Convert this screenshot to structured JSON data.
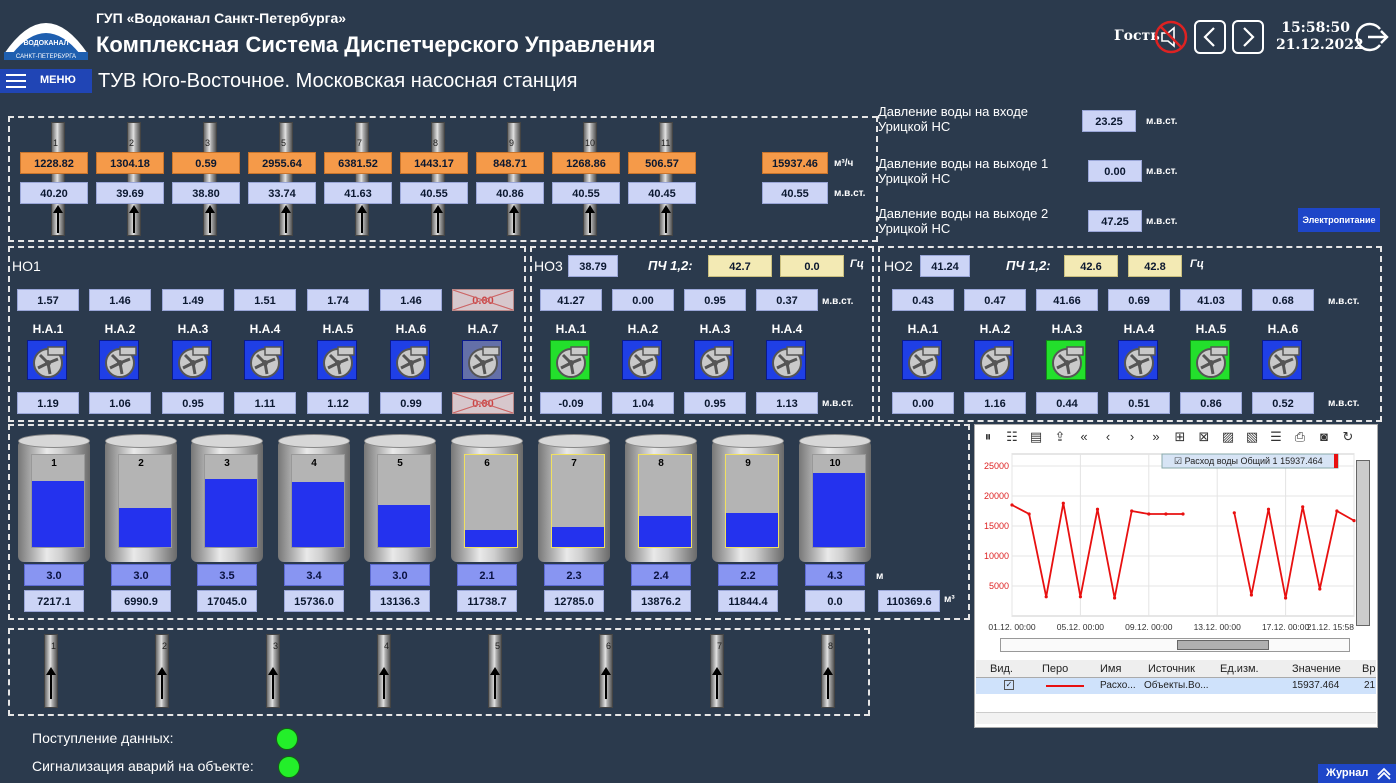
{
  "header": {
    "org": "ГУП «Водоканал Санкт-Петербурга»",
    "system": "Комплексная Система Диспетчерского Управления",
    "logo_top": "ВОДОКАНАЛ",
    "logo_bottom": "САНКТ-ПЕТЕРБУРГА",
    "user": "Гость",
    "time": "15:58:50",
    "date": "21.12.2022"
  },
  "nav": {
    "menu": "МЕНЮ",
    "title": "ТУВ Юго-Восточное. Московская насосная станция"
  },
  "pipes_top": {
    "labels": [
      "1",
      "2",
      "3",
      "5",
      "7",
      "8",
      "9",
      "10",
      "11"
    ],
    "flow": [
      "1228.82",
      "1304.18",
      "0.59",
      "2955.64",
      "6381.52",
      "1443.17",
      "848.71",
      "1268.86",
      "506.57"
    ],
    "pressure": [
      "40.20",
      "39.69",
      "38.80",
      "33.74",
      "41.63",
      "40.55",
      "40.86",
      "40.55",
      "40.45"
    ],
    "total_flow": "15937.46",
    "total_pressure": "40.55",
    "unit_flow": "м³/ч",
    "unit_pressure": "м.в.ст."
  },
  "uritsk": {
    "in_label": "Давление воды на входе Урицкой НС",
    "in_value": "23.25",
    "out1_label": "Давление воды на выходе 1 Урицкой НС",
    "out1_value": "0.00",
    "out2_label": "Давление воды на выходе 2 Урицкой НС",
    "out2_value": "47.25",
    "unit": "м.в.ст.",
    "power_button": "Электропитание"
  },
  "ho1": {
    "title": "НО1",
    "top": [
      "1.57",
      "1.46",
      "1.49",
      "1.51",
      "1.74",
      "1.46",
      "0.00"
    ],
    "pumps": [
      "Н.А.1",
      "Н.А.2",
      "Н.А.3",
      "Н.А.4",
      "Н.А.5",
      "Н.А.6",
      "Н.А.7"
    ],
    "bottom": [
      "1.19",
      "1.06",
      "0.95",
      "1.11",
      "1.12",
      "0.99",
      "0.00"
    ]
  },
  "ho3": {
    "title": "НО3",
    "value": "38.79",
    "pch_label": "ПЧ 1,2:",
    "pch1": "42.7",
    "pch2": "0.0",
    "hz": "Гц",
    "top": [
      "41.27",
      "0.00",
      "0.95",
      "0.37"
    ],
    "pumps": [
      "Н.А.1",
      "Н.А.2",
      "Н.А.3",
      "Н.А.4"
    ],
    "bottom": [
      "-0.09",
      "1.04",
      "0.95",
      "1.13"
    ],
    "unit": "м.в.ст."
  },
  "ho2": {
    "title": "НО2",
    "value": "41.24",
    "pch_label": "ПЧ 1,2:",
    "pch1": "42.6",
    "pch2": "42.8",
    "hz": "Гц",
    "top": [
      "0.43",
      "0.47",
      "41.66",
      "0.69",
      "41.03",
      "0.68"
    ],
    "pumps": [
      "Н.А.1",
      "Н.А.2",
      "Н.А.3",
      "Н.А.4",
      "Н.А.5",
      "Н.А.6"
    ],
    "bottom": [
      "0.00",
      "1.16",
      "0.44",
      "0.51",
      "0.86",
      "0.52"
    ],
    "unit": "м.в.ст."
  },
  "tanks": {
    "names": [
      "1",
      "2",
      "3",
      "4",
      "5",
      "6",
      "7",
      "8",
      "9",
      "10"
    ],
    "fill": [
      0.72,
      0.42,
      0.74,
      0.71,
      0.46,
      0.18,
      0.22,
      0.34,
      0.37,
      0.8
    ],
    "level": [
      "3.0",
      "3.0",
      "3.5",
      "3.4",
      "3.0",
      "2.1",
      "2.3",
      "2.4",
      "2.2",
      "4.3"
    ],
    "volume": [
      "7217.1",
      "6990.9",
      "17045.0",
      "15736.0",
      "13136.3",
      "11738.7",
      "12785.0",
      "13876.2",
      "11844.4",
      "0.0"
    ],
    "total_volume": "110369.6",
    "unit_level": "м",
    "unit_volume": "м³"
  },
  "pipes_bottom": {
    "labels": [
      "1",
      "2",
      "3",
      "4",
      "5",
      "6",
      "7",
      "8"
    ]
  },
  "status": {
    "data_label": "Поступление данных:",
    "alarm_label": "Сигнализация аварий на объекте:"
  },
  "journal": "Журнал",
  "chart_data": {
    "type": "line",
    "series": [
      {
        "name": "Расход воды Общий 1",
        "legend_value": "15937.464",
        "color": "#e81010",
        "x": [
          "01.12",
          "02.12",
          "03.12",
          "04.12",
          "05.12",
          "06.12",
          "07.12",
          "08.12",
          "09.12",
          "10.12",
          "11.12",
          "12.12",
          "13.12",
          "14.12",
          "15.12",
          "16.12",
          "17.12",
          "18.12",
          "19.12",
          "20.12",
          "21.12"
        ],
        "values": [
          18500,
          17000,
          3200,
          18800,
          3200,
          17800,
          3000,
          17500,
          17000,
          17000,
          17000,
          null,
          null,
          17200,
          3500,
          17800,
          3000,
          18200,
          4500,
          17500,
          15900
        ]
      }
    ],
    "y_ticks": [
      "25000",
      "20000",
      "15000",
      "10000",
      "5000"
    ],
    "x_ticks": [
      "01.12. 00:00",
      "05.12. 00:00",
      "09.12. 00:00",
      "13.12. 00:00",
      "17.12. 00:00",
      "21.12. 15:58"
    ],
    "ylim": [
      0,
      27000
    ],
    "grid": true,
    "legend": "top"
  },
  "table": {
    "headers": [
      "Вид.",
      "Перо",
      "Имя",
      "Источник",
      "Ед.изм.",
      "Значение",
      "Вр"
    ],
    "row": {
      "name": "Расхо...",
      "source": "Объекты.Во...",
      "unit": "",
      "value": "15937.464",
      "time": "21"
    }
  }
}
